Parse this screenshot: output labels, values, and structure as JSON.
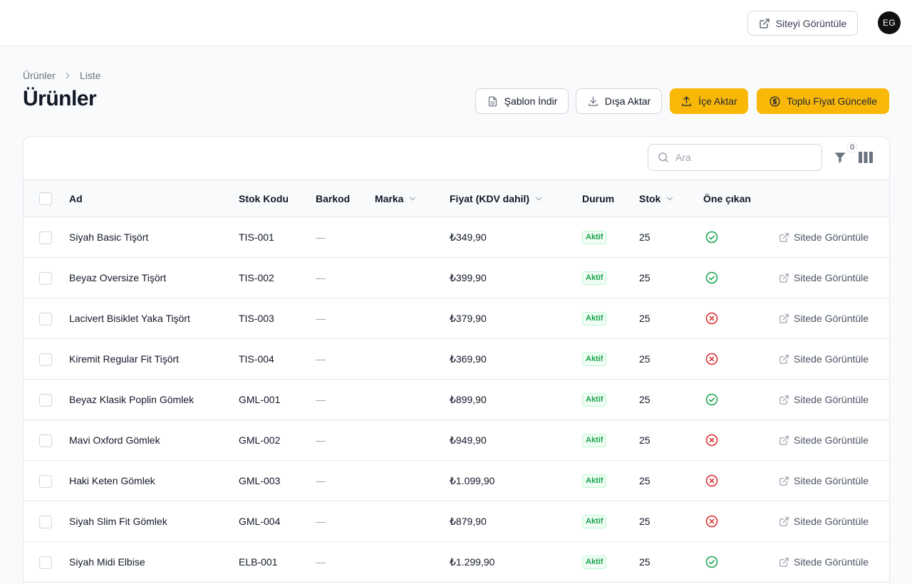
{
  "topbar": {
    "view_site_label": "Siteyi Görüntüle",
    "avatar_initials": "EG"
  },
  "breadcrumb": [
    "Ürünler",
    "Liste"
  ],
  "page_title": "Ürünler",
  "actions": {
    "template_download": "Şablon İndir",
    "export": "Dışa Aktar",
    "import": "İçe Aktar",
    "bulk_price": "Toplu Fiyat Güncelle"
  },
  "toolbar": {
    "search_placeholder": "Ara",
    "filter_count": "0"
  },
  "columns": {
    "name": "Ad",
    "sku": "Stok Kodu",
    "barcode": "Barkod",
    "brand": "Marka",
    "price": "Fiyat (KDV dahil)",
    "status": "Durum",
    "stock": "Stok",
    "featured": "Öne çıkan"
  },
  "rows": [
    {
      "name": "Siyah Basic Tişört",
      "sku": "TIS-001",
      "barcode": "—",
      "brand": "",
      "price": "₺349,90",
      "status": "Aktif",
      "stock": "25",
      "featured": true,
      "action": "Sitede Görüntüle"
    },
    {
      "name": "Beyaz Oversize Tişört",
      "sku": "TIS-002",
      "barcode": "—",
      "brand": "",
      "price": "₺399,90",
      "status": "Aktif",
      "stock": "25",
      "featured": true,
      "action": "Sitede Görüntüle"
    },
    {
      "name": "Lacivert Bisiklet Yaka Tişört",
      "sku": "TIS-003",
      "barcode": "—",
      "brand": "",
      "price": "₺379,90",
      "status": "Aktif",
      "stock": "25",
      "featured": false,
      "action": "Sitede Görüntüle"
    },
    {
      "name": "Kiremit Regular Fit Tişört",
      "sku": "TIS-004",
      "barcode": "—",
      "brand": "",
      "price": "₺369,90",
      "status": "Aktif",
      "stock": "25",
      "featured": false,
      "action": "Sitede Görüntüle"
    },
    {
      "name": "Beyaz Klasik Poplin Gömlek",
      "sku": "GML-001",
      "barcode": "—",
      "brand": "",
      "price": "₺899,90",
      "status": "Aktif",
      "stock": "25",
      "featured": true,
      "action": "Sitede Görüntüle"
    },
    {
      "name": "Mavi Oxford Gömlek",
      "sku": "GML-002",
      "barcode": "—",
      "brand": "",
      "price": "₺949,90",
      "status": "Aktif",
      "stock": "25",
      "featured": false,
      "action": "Sitede Görüntüle"
    },
    {
      "name": "Haki Keten Gömlek",
      "sku": "GML-003",
      "barcode": "—",
      "brand": "",
      "price": "₺1.099,90",
      "status": "Aktif",
      "stock": "25",
      "featured": false,
      "action": "Sitede Görüntüle"
    },
    {
      "name": "Siyah Slim Fit Gömlek",
      "sku": "GML-004",
      "barcode": "—",
      "brand": "",
      "price": "₺879,90",
      "status": "Aktif",
      "stock": "25",
      "featured": false,
      "action": "Sitede Görüntüle"
    },
    {
      "name": "Siyah Midi Elbise",
      "sku": "ELB-001",
      "barcode": "—",
      "brand": "",
      "price": "₺1.299,90",
      "status": "Aktif",
      "stock": "25",
      "featured": true,
      "action": "Sitede Görüntüle"
    }
  ],
  "colors": {
    "accent": "#f9b708",
    "success": "#16a34a",
    "danger": "#dc2626"
  }
}
